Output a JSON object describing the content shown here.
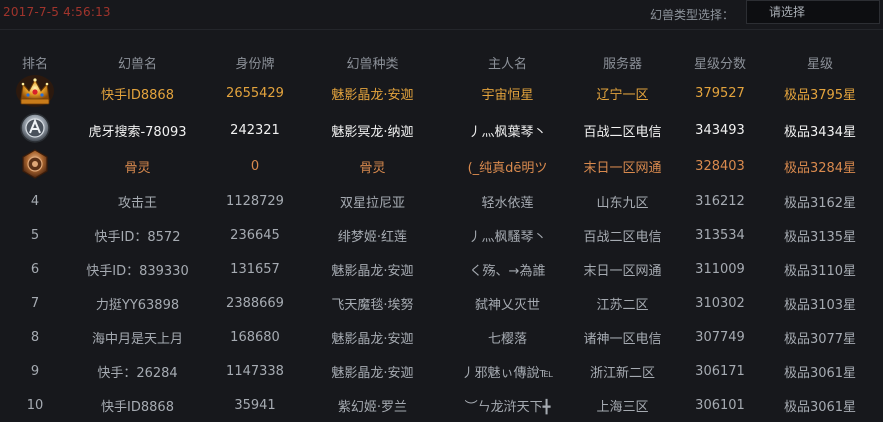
{
  "timestamp": "2017-7-5 4:56:13",
  "filter": {
    "label": "幻兽类型选择：",
    "value": "请选择"
  },
  "columns": [
    "排名",
    "幻兽名",
    "身份牌",
    "幻兽种类",
    "主人名",
    "服务器",
    "星级分数",
    "星级"
  ],
  "rows": [
    {
      "rank": "",
      "medal": "gold-crown-icon",
      "name": "快手ID8868",
      "id": "2655429",
      "type": "魅影晶龙·安迦",
      "owner": "宇宙恒星",
      "server": "辽宁一区",
      "score": "379527",
      "level": "极品3795星"
    },
    {
      "rank": "",
      "medal": "silver-emblem-icon",
      "name": "虎牙搜索-78093",
      "id": "242321",
      "type": "魅影冥龙·纳迦",
      "owner": "丿灬枫葉琴丶",
      "server": "百战二区电信",
      "score": "343493",
      "level": "极品3434星"
    },
    {
      "rank": "",
      "medal": "bronze-emblem-icon",
      "name": "骨灵",
      "id": "0",
      "type": "骨灵",
      "owner": "(_纯真dē明ツ",
      "server": "末日一区网通",
      "score": "328403",
      "level": "极品3284星"
    },
    {
      "rank": "4",
      "name": "攻击王",
      "id": "1128729",
      "type": "双星拉尼亚",
      "owner": "轻水依莲",
      "server": "山东九区",
      "score": "316212",
      "level": "极品3162星"
    },
    {
      "rank": "5",
      "name": "快手ID：8572",
      "id": "236645",
      "type": "绯梦姬·红莲",
      "owner": "丿灬枫騷琴丶",
      "server": "百战二区电信",
      "score": "313534",
      "level": "极品3135星"
    },
    {
      "rank": "6",
      "name": "快手ID：839330",
      "id": "131657",
      "type": "魅影晶龙·安迦",
      "owner": "く殇、→為誰",
      "server": "末日一区网通",
      "score": "311009",
      "level": "极品3110星"
    },
    {
      "rank": "7",
      "name": "力挺YY63898",
      "id": "2388669",
      "type": "飞天魔毯·埃努",
      "owner": "弑神乂灭世",
      "server": "江苏二区",
      "score": "310302",
      "level": "极品3103星"
    },
    {
      "rank": "8",
      "name": "海中月是天上月",
      "id": "168680",
      "type": "魅影晶龙·安迦",
      "owner": "七樱落",
      "server": "诸神一区电信",
      "score": "307749",
      "level": "极品3077星"
    },
    {
      "rank": "9",
      "name": "快手：26284",
      "id": "1147338",
      "type": "魅影晶龙·安迦",
      "owner": "丿邪魅ぃ傳說℡",
      "server": "浙江新二区",
      "score": "306171",
      "level": "极品3061星"
    },
    {
      "rank": "10",
      "name": "快手ID8868",
      "id": "35941",
      "type": "紫幻姬·罗兰",
      "owner": "︶ㄣ龙浒天下╋",
      "server": "上海三区",
      "score": "306101",
      "level": "极品3061星"
    }
  ]
}
